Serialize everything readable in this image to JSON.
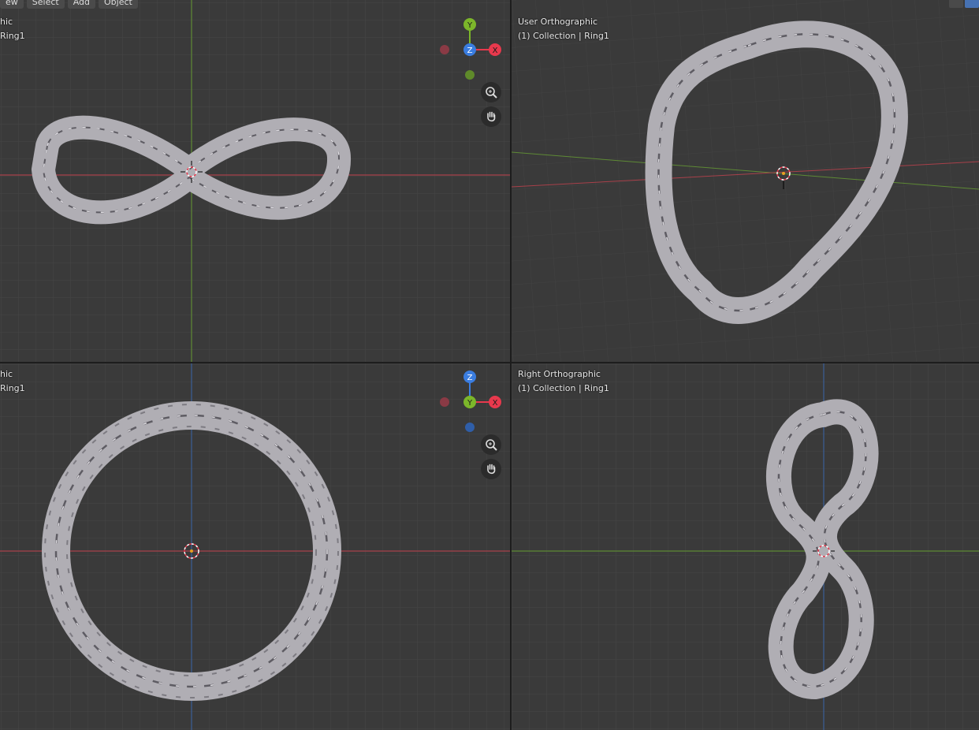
{
  "menu": {
    "items": [
      "ew",
      "Select",
      "Add",
      "Object"
    ]
  },
  "viewports": {
    "top_left": {
      "view": "hic",
      "context": "Ring1"
    },
    "top_right": {
      "view": "User Orthographic",
      "context": "(1) Collection | Ring1"
    },
    "bottom_left": {
      "view": "hic",
      "context": "Ring1"
    },
    "bottom_right": {
      "view": "Right Orthographic",
      "context": "(1) Collection | Ring1"
    }
  },
  "gizmo_top": {
    "up": "Y",
    "center": "Z",
    "right": "X"
  },
  "gizmo_bottom": {
    "up": "Z",
    "center": "Y",
    "right": "X"
  },
  "icons": [
    "zoom-icon",
    "hand-pan-icon",
    "cursor-select-icon",
    "navigation-gizmo-icon"
  ],
  "colors": {
    "x_axis": "#e8394d",
    "y_axis": "#7cb62a",
    "z_axis": "#3a7de0",
    "grid": "#4a4a4a",
    "viewport_bg": "#3a3a3a",
    "ring": "#b4b2b8"
  }
}
